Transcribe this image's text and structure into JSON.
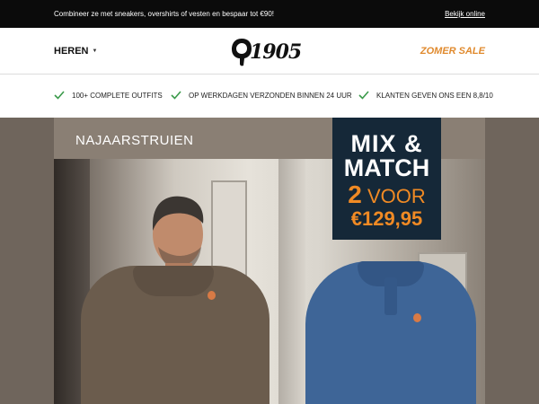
{
  "topbar": {
    "promo": "Combineer ze met sneakers, overshirts of vesten en bespaar tot €90!",
    "online_link": "Bekijk online"
  },
  "header": {
    "menu_label": "HEREN",
    "logo_text": "1905",
    "sale_label": "ZOMER SALE"
  },
  "usps": [
    {
      "icon": "check-icon",
      "label": "100+ COMPLETE OUTFITS"
    },
    {
      "icon": "check-icon",
      "label": "OP WERKDAGEN VERZONDEN BINNEN 24 UUR"
    },
    {
      "icon": "check-icon",
      "label": "KLANTEN GEVEN ONS EEN 8,8/10"
    }
  ],
  "hero": {
    "category": "NAJAARSTRUIEN",
    "badge": {
      "line1": "MIX &",
      "line2": "MATCH",
      "qty": "2",
      "voor": "VOOR",
      "price": "€129,95"
    }
  },
  "colors": {
    "accent": "#e08a2e",
    "badge_bg": "#152838",
    "badge_price": "#f08a24",
    "check": "#3a9a4a"
  }
}
